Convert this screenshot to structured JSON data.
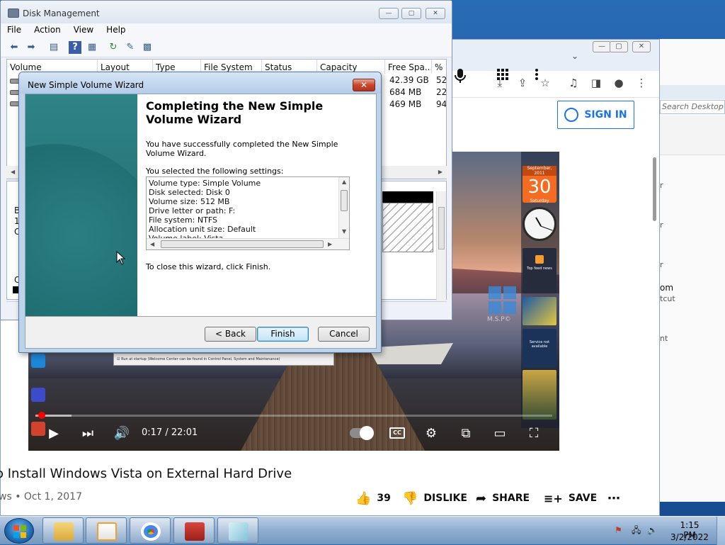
{
  "disk_management": {
    "title": "Disk Management",
    "menu": [
      "File",
      "Action",
      "View",
      "Help"
    ],
    "columns": [
      "Volume",
      "Layout",
      "Type",
      "File System",
      "Status",
      "Capacity",
      "Free Spa...",
      "% F"
    ],
    "rows": [
      {
        "free": "42.39 GB",
        "pct": "52"
      },
      {
        "free": "684 MB",
        "pct": "22"
      },
      {
        "free": "469 MB",
        "pct": "94"
      }
    ],
    "lower_labels": [
      "B",
      "1",
      "C",
      "C"
    ]
  },
  "wizard": {
    "title": "New Simple Volume Wizard",
    "heading": "Completing the New Simple Volume Wizard",
    "success_text": "You have successfully completed the New Simple Volume Wizard.",
    "settings_label": "You selected the following settings:",
    "settings": [
      "Volume type: Simple Volume",
      "Disk selected: Disk 0",
      "Volume size: 512 MB",
      "Drive letter or path: F:",
      "File system: NTFS",
      "Allocation unit size: Default",
      "Volume label: Vista"
    ],
    "close_text": "To close this wizard, click Finish.",
    "buttons": {
      "back": "< Back",
      "finish": "Finish",
      "cancel": "Cancel"
    },
    "close_glyph": "✕"
  },
  "youtube": {
    "signin": "SIGN IN",
    "player": {
      "time": "0:17 / 22:01",
      "progress_fraction": 0.013,
      "buffered_fraction": 0.07
    },
    "gadget_day": "30",
    "gadget_month": "September, 2011",
    "gadget_weekday": "Saturday",
    "gadget_feed": "Top feed news",
    "gadget_service": "Service not available",
    "wallpaper_brand": "M.S.P©",
    "setup_box_text": "Run at startup (Welcome Center can be found in Control Panel, System and Maintenance)",
    "video_title": "o Install Windows Vista on External Hard Drive",
    "video_meta": "ws • Oct 1, 2017",
    "actions": {
      "likes": "39",
      "dislike": "DISLIKE",
      "share": "SHARE",
      "save": "SAVE"
    }
  },
  "desktop_panel": {
    "search_placeholder": "Search Desktop",
    "fragments": [
      "r",
      "r",
      "r",
      "om",
      "tcut",
      "nt"
    ]
  },
  "taskbar": {
    "time": "1:15 PM",
    "date": "3/2/2022"
  },
  "colors": {
    "wizard_banner": "#1f7174",
    "youtube_blue": "#1a73e8",
    "progress_red": "#ff0000",
    "taskbar": "#8eadd0"
  }
}
